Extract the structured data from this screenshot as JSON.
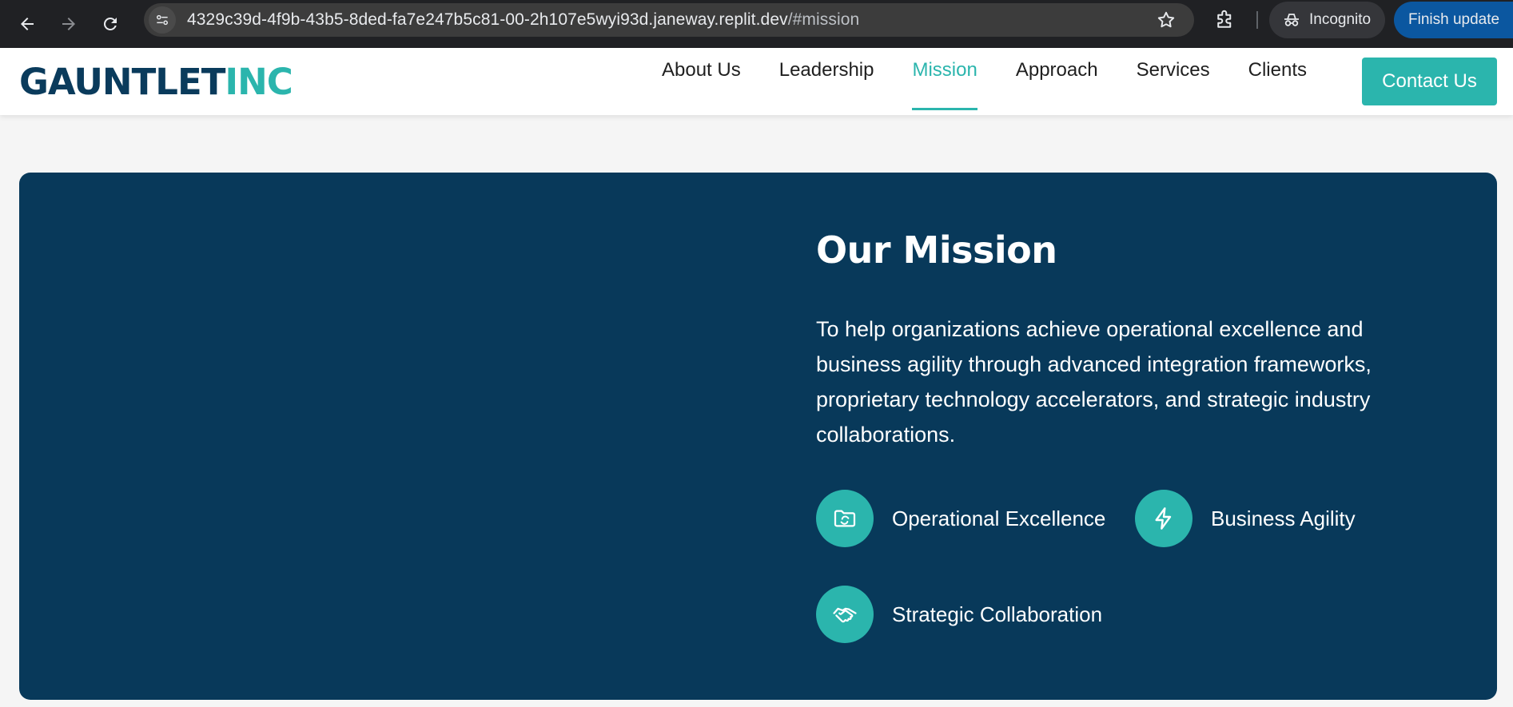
{
  "browser": {
    "url_main": "4329c39d-4f9b-43b5-8ded-fa7e247b5c81-00-2h107e5wyi93d.janeway.replit.dev",
    "url_fragment": "/#mission",
    "incognito_label": "Incognito",
    "update_label": "Finish update",
    "icons": [
      "back-icon",
      "forward-icon",
      "reload-icon",
      "site-info-icon",
      "bookmark-star-icon",
      "extensions-icon",
      "incognito-icon",
      "more-icon"
    ]
  },
  "header": {
    "logo_part1": "GAUNTLET",
    "logo_part2": "INC",
    "nav": [
      {
        "label": "About Us",
        "active": false
      },
      {
        "label": "Leadership",
        "active": false
      },
      {
        "label": "Mission",
        "active": true
      },
      {
        "label": "Approach",
        "active": false
      },
      {
        "label": "Services",
        "active": false
      },
      {
        "label": "Clients",
        "active": false
      }
    ],
    "contact_label": "Contact Us"
  },
  "mission": {
    "title": "Our Mission",
    "text": "To help organizations achieve operational excellence and business agility through advanced integration frameworks, proprietary technology accelerators, and strategic industry collaborations.",
    "features": [
      {
        "label": "Operational Excellence",
        "icon": "folder-sync-icon"
      },
      {
        "label": "Business Agility",
        "icon": "lightning-icon"
      },
      {
        "label": "Strategic Collaboration",
        "icon": "handshake-icon"
      }
    ]
  },
  "colors": {
    "brand_navy": "#0a3b5c",
    "brand_teal": "#2bb5ad",
    "section_bg": "#08395a"
  }
}
